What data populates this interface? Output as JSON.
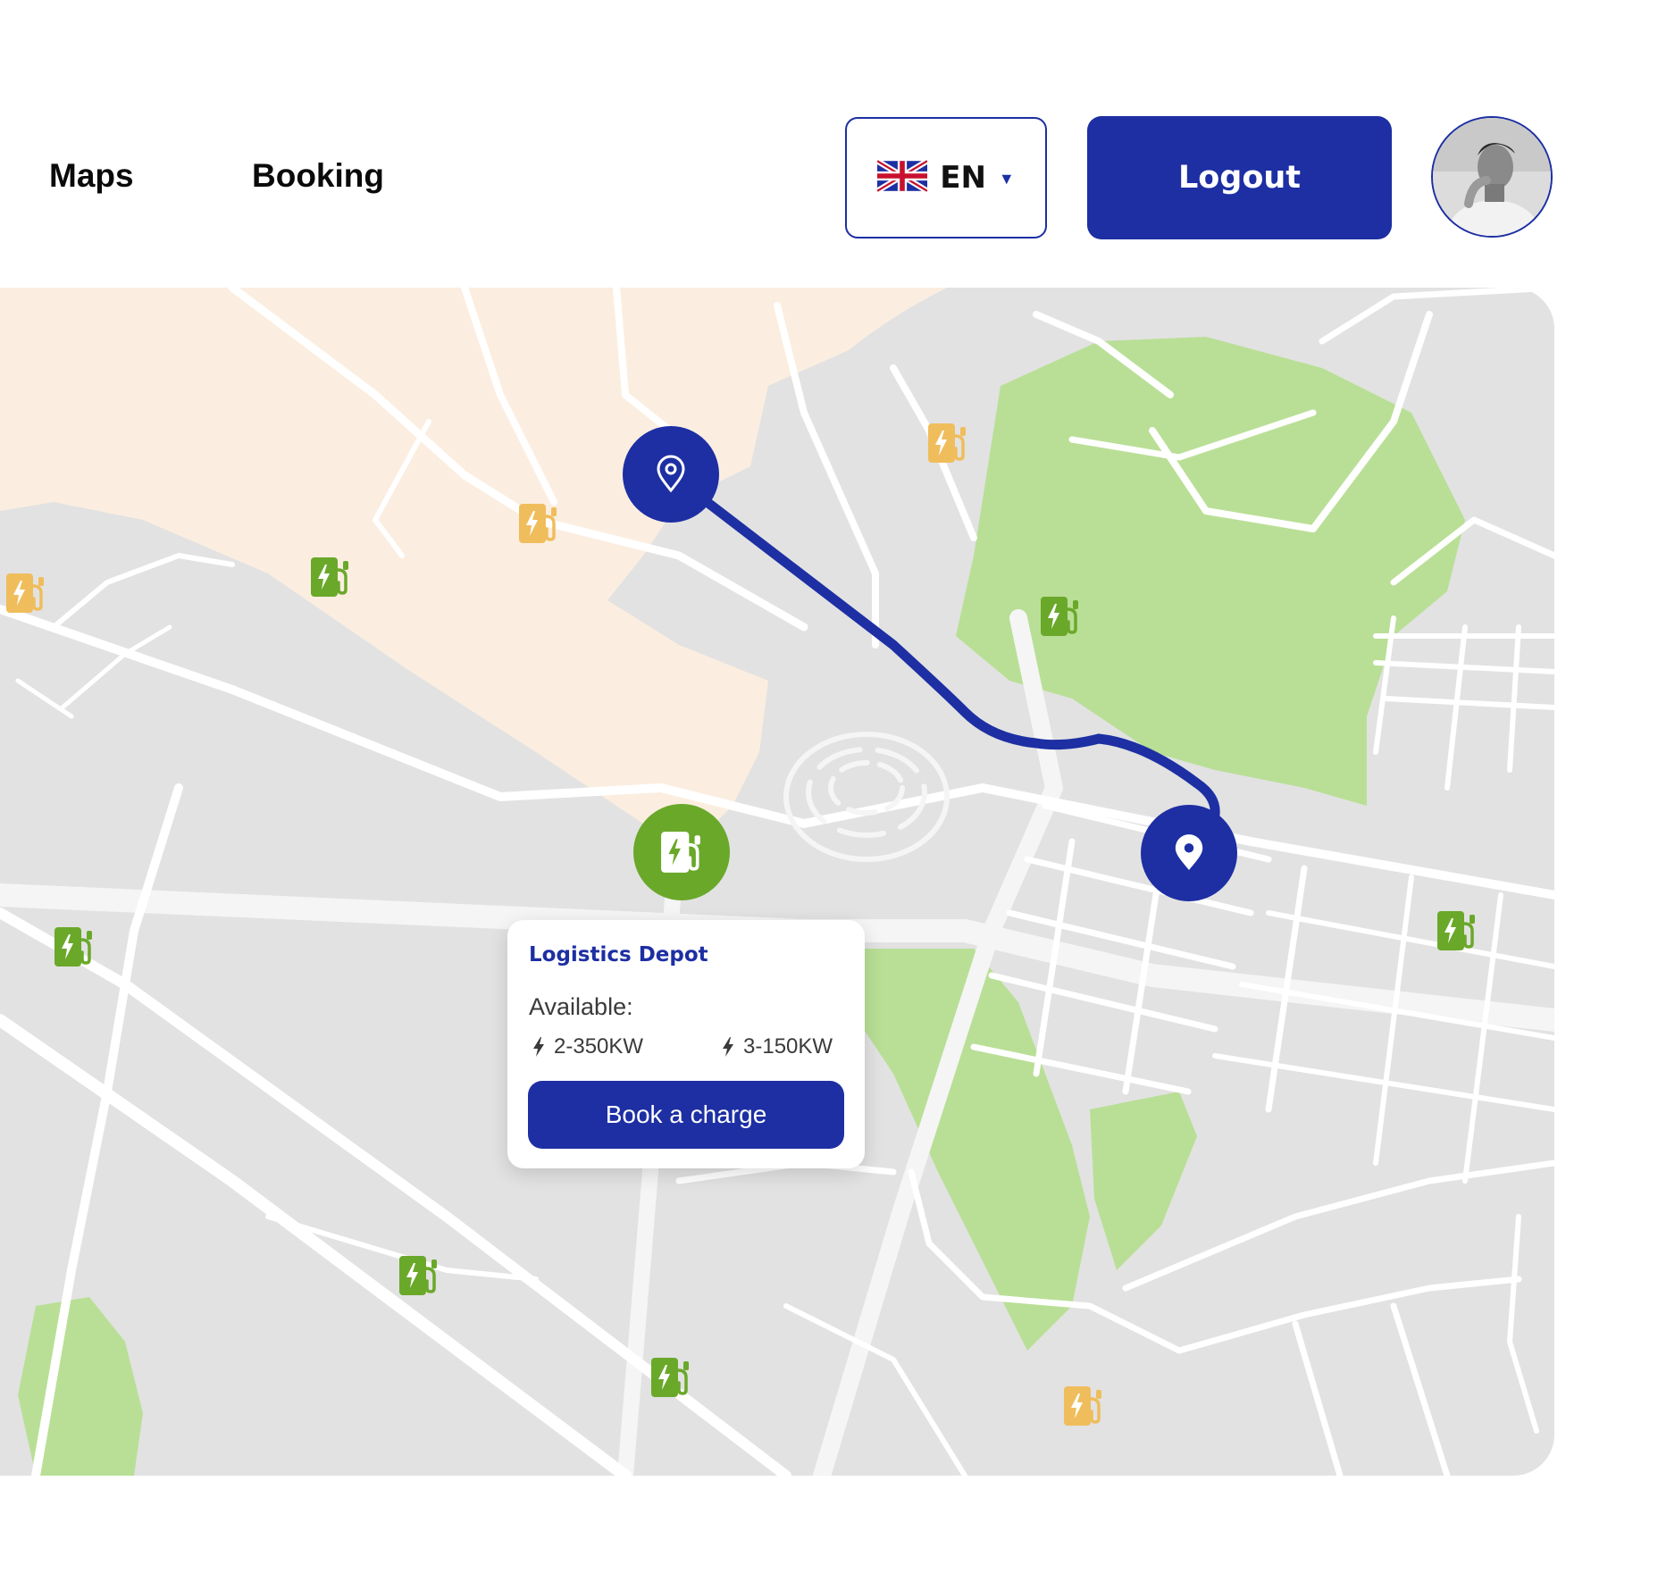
{
  "nav": {
    "items": [
      {
        "label": "Maps"
      },
      {
        "label": "Booking"
      }
    ]
  },
  "header": {
    "language": {
      "code": "EN",
      "flag_icon": "uk-flag-icon",
      "caret_icon": "caret-down-icon"
    },
    "logout_label": "Logout",
    "avatar_icon": "user-avatar"
  },
  "map": {
    "route_color": "#1d2fa3",
    "available_station_color": "#6aa82a",
    "busy_station_color": "#f0bd5c",
    "origin_icon": "location-outline-icon",
    "destination_icon": "location-filled-icon"
  },
  "popup": {
    "title": "Logistics Depot",
    "available_label": "Available:",
    "plugs": [
      {
        "label": "2-350KW",
        "icon": "lightning-icon"
      },
      {
        "label": "3-150KW",
        "icon": "lightning-icon"
      }
    ],
    "book_label": "Book a charge"
  },
  "colors": {
    "accent": "#1d2fa3",
    "park": "#b9df96",
    "urban": "#fbeee0",
    "map_bg": "#e2e2e2"
  }
}
